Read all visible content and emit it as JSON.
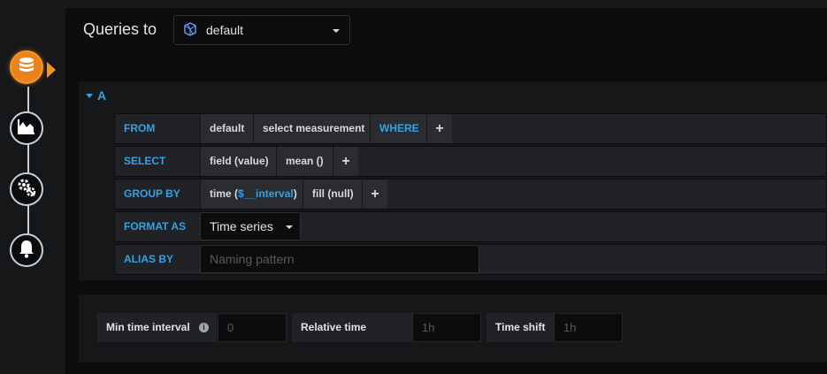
{
  "header": {
    "title": "Queries to",
    "datasource": "default",
    "datasource_icon": "influxdb-icon"
  },
  "steps": [
    {
      "name": "queries",
      "icon": "database-icon",
      "active": true
    },
    {
      "name": "visualization",
      "icon": "area-chart-icon",
      "active": false
    },
    {
      "name": "general",
      "icon": "gears-icon",
      "active": false
    },
    {
      "name": "alert",
      "icon": "bell-icon",
      "active": false
    }
  ],
  "query": {
    "ref": "A",
    "from": {
      "label": "FROM",
      "policy": "default",
      "measurement": "select measurement",
      "where": "WHERE",
      "add": "+"
    },
    "select": {
      "label": "SELECT",
      "field": "field (value)",
      "fn": "mean ()",
      "add": "+"
    },
    "group_by": {
      "label": "GROUP BY",
      "time_pre": "time (",
      "time_var": "$__interval",
      "time_post": ")",
      "fill": "fill (null)",
      "add": "+"
    },
    "format_as": {
      "label": "FORMAT AS",
      "value": "Time series"
    },
    "alias_by": {
      "label": "ALIAS BY",
      "placeholder": "Naming pattern"
    }
  },
  "options": {
    "min_interval_label": "Min time interval",
    "min_interval_placeholder": "0",
    "relative_time_label": "Relative time",
    "relative_time_placeholder": "1h",
    "time_shift_label": "Time shift",
    "time_shift_placeholder": "1h"
  },
  "colors": {
    "accent": "#33a2e5",
    "active_step": "#f7941e",
    "background": "#0b0c0e"
  }
}
